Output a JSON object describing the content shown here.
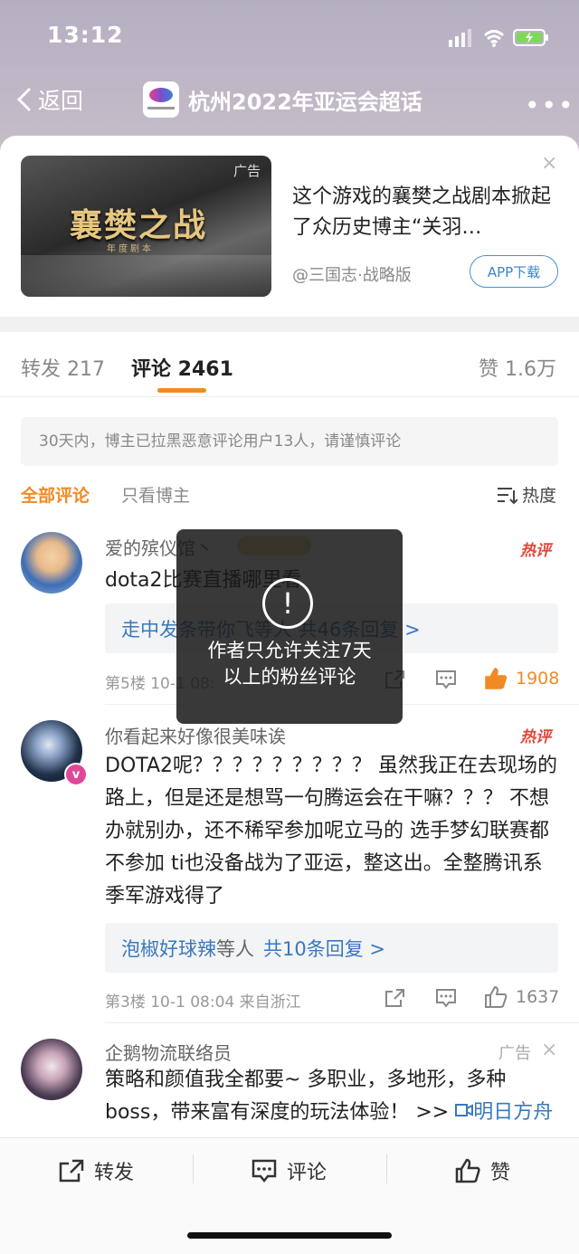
{
  "status_bar": {
    "time": "13:12"
  },
  "nav": {
    "back_label": "返回",
    "title": "杭州2022年亚运会超话",
    "more": "•••"
  },
  "ad": {
    "tag": "广告",
    "image_title": "襄樊之战",
    "image_subtitle": "年度剧本",
    "text": "这个游戏的襄樊之战剧本掀起了众历史博主“关羽…",
    "source": "@三国志·战略版",
    "button": "APP下载",
    "close": "×"
  },
  "tabs": {
    "repost": "转发 217",
    "comments": "评论 2461",
    "likes": "赞 1.6万"
  },
  "notice": "30天内，博主已拉黑恶意评论用户13人，请谨慎评论",
  "filters": {
    "all": "全部评论",
    "host_only": "只看博主",
    "sort": "热度"
  },
  "comments": [
    {
      "user": "爱的殡仪馆丶",
      "hot": "热评",
      "text": "dota2比赛直播哪里看",
      "reply": "走中发条带你飞等人 共46条回复 >",
      "meta": "第5楼 10-1 08:",
      "likes": "1908"
    },
    {
      "user": "你看起来好像很美味诶",
      "hot": "热评",
      "text": "DOTA2呢？？？？？？？？？ 虽然我正在去现场的路上，但是还是想骂一句腾运会在干嘛？？？ 不想办就别办，还不稀罕参加呢立马的 选手梦幻联赛都不参加 ti也没备战为了亚运，整这出。全整腾讯系季军游戏得了",
      "reply_user": "泡椒好球辣",
      "reply_mid": "等人",
      "reply_count": "共10条回复 >",
      "meta": "第3楼 10-1 08:04 来自浙江",
      "likes": "1637"
    },
    {
      "user": "企鹅物流联络员",
      "tag": "广告",
      "text": "策略和颜值我全都要~ 多职业，多地形，多种boss，带来富有深度的玩法体验！ >>",
      "link": "明日方舟"
    }
  ],
  "bottom": {
    "repost": "转发",
    "comment": "评论",
    "like": "赞"
  },
  "toast": {
    "text": "作者只允许关注7天以上的粉丝评论"
  },
  "colors": {
    "accent": "#f08a24",
    "link": "#3a78bd",
    "hot": "#e0473b"
  }
}
